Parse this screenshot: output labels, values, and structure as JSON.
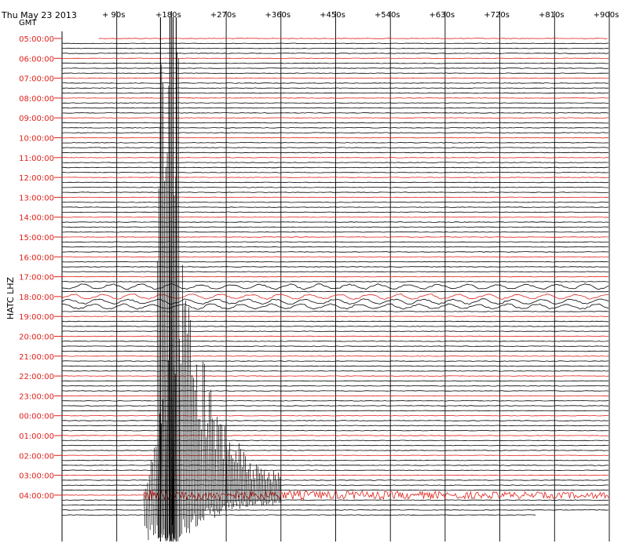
{
  "chart_data": {
    "type": "line",
    "date_label": "Thu May 23 2013",
    "timezone_label": "GMT",
    "ylabel": "HATC LHZ",
    "x_ticks": [
      "+ 90s",
      "+180s",
      "+270s",
      "+360s",
      "+450s",
      "+540s",
      "+630s",
      "+720s",
      "+810s",
      "+900s"
    ],
    "xlim": [
      0,
      900
    ],
    "hour_labels": [
      "05:00:00",
      "06:00:00",
      "07:00:00",
      "08:00:00",
      "09:00:00",
      "10:00:00",
      "11:00:00",
      "12:00:00",
      "13:00:00",
      "14:00:00",
      "15:00:00",
      "16:00:00",
      "17:00:00",
      "18:00:00",
      "19:00:00",
      "20:00:00",
      "21:00:00",
      "22:00:00",
      "23:00:00",
      "00:00:00",
      "01:00:00",
      "02:00:00",
      "03:00:00",
      "04:00:00"
    ],
    "traces_per_hour": 4,
    "first_row_start_s": 60,
    "last_row_end_s": 780,
    "event": {
      "hour_label": "04:00:00",
      "onset_s": 135,
      "peak_s": 180,
      "coda_end_s": 900
    },
    "noisy_hours": [
      "17:00:00",
      "18:00:00"
    ],
    "grid": true,
    "colors": {
      "hour_trace": "#e0201a",
      "trace": "#000000",
      "label": "#e0201a",
      "grid": "#000000"
    }
  }
}
